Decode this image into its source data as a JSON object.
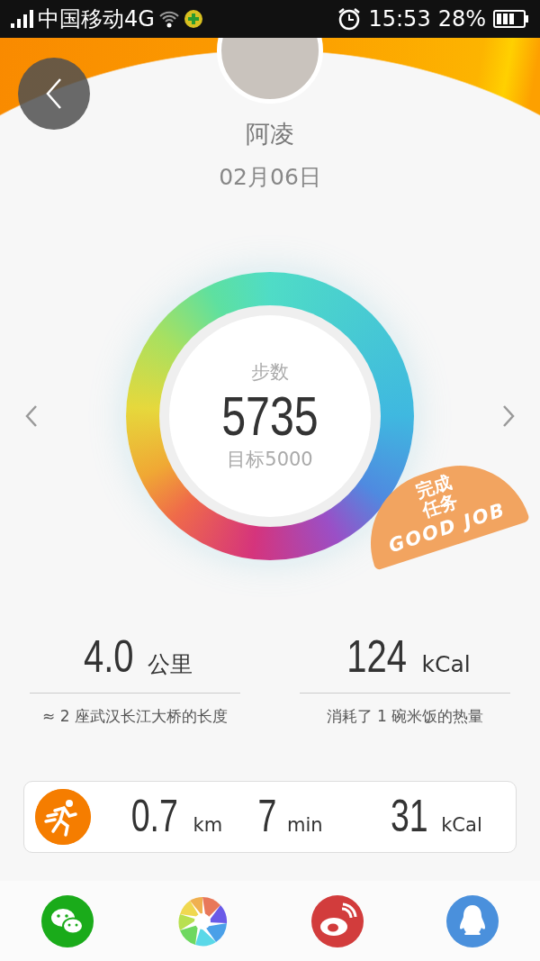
{
  "status_bar": {
    "carrier": "中国移动4G",
    "time": "15:53",
    "battery": "28%"
  },
  "profile": {
    "name": "阿凌",
    "date": "02月06日"
  },
  "steps": {
    "label": "步数",
    "value": "5735",
    "goal": "目标5000"
  },
  "stamp": {
    "line_1": "完成",
    "line_2": "任务",
    "line_3": "GOOD JOB"
  },
  "stats": [
    {
      "value": "4.0",
      "unit": "公里",
      "caption": "≈ 2 座武汉长江大桥的长度"
    },
    {
      "value": "124",
      "unit": "kCal",
      "caption": "消耗了 1 碗米饭的热量"
    }
  ],
  "activity": {
    "kind": "run",
    "items": [
      {
        "value": "0.7",
        "unit": "km"
      },
      {
        "value": "7",
        "unit": "min"
      },
      {
        "value": "31",
        "unit": "kCal"
      }
    ]
  },
  "share": [
    {
      "kind": "wechat"
    },
    {
      "kind": "moments"
    },
    {
      "kind": "weibo"
    },
    {
      "kind": "qq"
    }
  ]
}
